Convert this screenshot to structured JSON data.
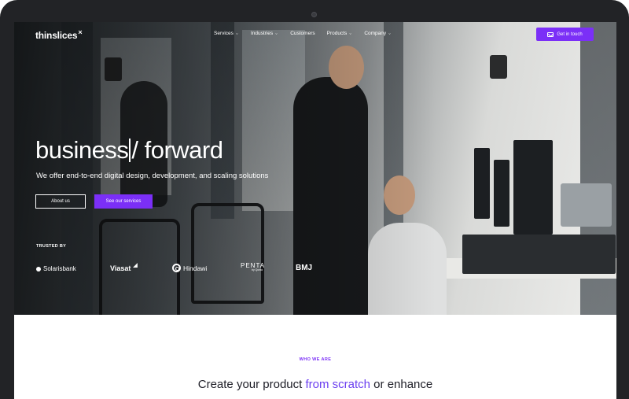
{
  "brand": {
    "name": "thinslices",
    "mark": "×",
    "accent_color": "#7b2ff7"
  },
  "nav": {
    "links": [
      {
        "label": "Services",
        "has_dropdown": true
      },
      {
        "label": "Industries",
        "has_dropdown": true
      },
      {
        "label": "Customers",
        "has_dropdown": false
      },
      {
        "label": "Products",
        "has_dropdown": true
      },
      {
        "label": "Company",
        "has_dropdown": true
      }
    ],
    "dropdown_icon": "chevron-down-icon",
    "cta_label": "Get in touch",
    "cta_icon": "mail-icon"
  },
  "hero": {
    "headline_prefix": "business",
    "headline_suffix": "/ forward",
    "subheadline": "We offer end-to-end digital design, development, and scaling solutions",
    "secondary_button": "About us",
    "primary_button": "See our services",
    "trusted_label": "TRUSTED BY",
    "logos": [
      {
        "name": "Solarisbank",
        "icon": "solarisbank-icon"
      },
      {
        "name": "Viasat",
        "icon": "viasat-wave-icon"
      },
      {
        "name": "Hindawi",
        "icon": "hindawi-ring-icon"
      },
      {
        "name": "PENTA",
        "tagline": "by Qonto"
      },
      {
        "name": "BMJ"
      }
    ]
  },
  "section": {
    "eyebrow": "WHO WE ARE",
    "title_start": "Create your product ",
    "title_accent": "from scratch",
    "title_end": " or enhance"
  }
}
